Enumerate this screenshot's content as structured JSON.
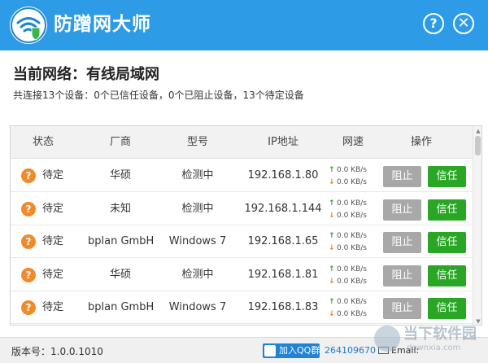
{
  "app": {
    "title": "防蹭网大师",
    "help_label": "?",
    "close_label": "✕"
  },
  "network": {
    "title": "当前网络：有线局域网",
    "summary": "共连接13个设备：0个已信任设备，0个已阻止设备，13个待定设备"
  },
  "table": {
    "headers": [
      "状态",
      "厂商",
      "型号",
      "IP地址",
      "网速",
      "操作"
    ],
    "rows": [
      {
        "status": "待定",
        "vendor": "华硕",
        "model": "检测中",
        "ip": "192.168.1.80",
        "up": "0.0 KB/s",
        "down": "0.0 KB/s",
        "block": "阻止",
        "trust": "信任"
      },
      {
        "status": "待定",
        "vendor": "未知",
        "model": "检测中",
        "ip": "192.168.1.144",
        "up": "0.0 KB/s",
        "down": "0.0 KB/s",
        "block": "阻止",
        "trust": "信任"
      },
      {
        "status": "待定",
        "vendor": "bplan GmbH",
        "model": "Windows 7",
        "ip": "192.168.1.65",
        "up": "0.0 KB/s",
        "down": "0.0 KB/s",
        "block": "阻止",
        "trust": "信任"
      },
      {
        "status": "待定",
        "vendor": "华硕",
        "model": "检测中",
        "ip": "192.168.1.81",
        "up": "0.0 KB/s",
        "down": "0.0 KB/s",
        "block": "阻止",
        "trust": "信任"
      },
      {
        "status": "待定",
        "vendor": "bplan GmbH",
        "model": "Windows 7",
        "ip": "192.168.1.83",
        "up": "0.0 KB/s",
        "down": "0.0 KB/s",
        "block": "阻止",
        "trust": "信任"
      }
    ]
  },
  "footer": {
    "version": "版本号：1.0.0.1010",
    "qq_button": "加入QQ群",
    "qq_number": "264109670",
    "email_label": "Email:"
  },
  "watermark": {
    "text": "当下软件园",
    "sub": "downxia.com"
  },
  "colors": {
    "titlebar": "#2e9be6",
    "trust_button": "#2aa625",
    "block_button": "#a8a8a8",
    "status_icon": "#f08a2a"
  },
  "icons": {
    "logo": "wifi-shield-icon",
    "status": "question-mark-icon",
    "upload": "arrow-up-icon",
    "download": "arrow-down-icon",
    "qq": "qq-icon",
    "email": "mail-icon"
  }
}
